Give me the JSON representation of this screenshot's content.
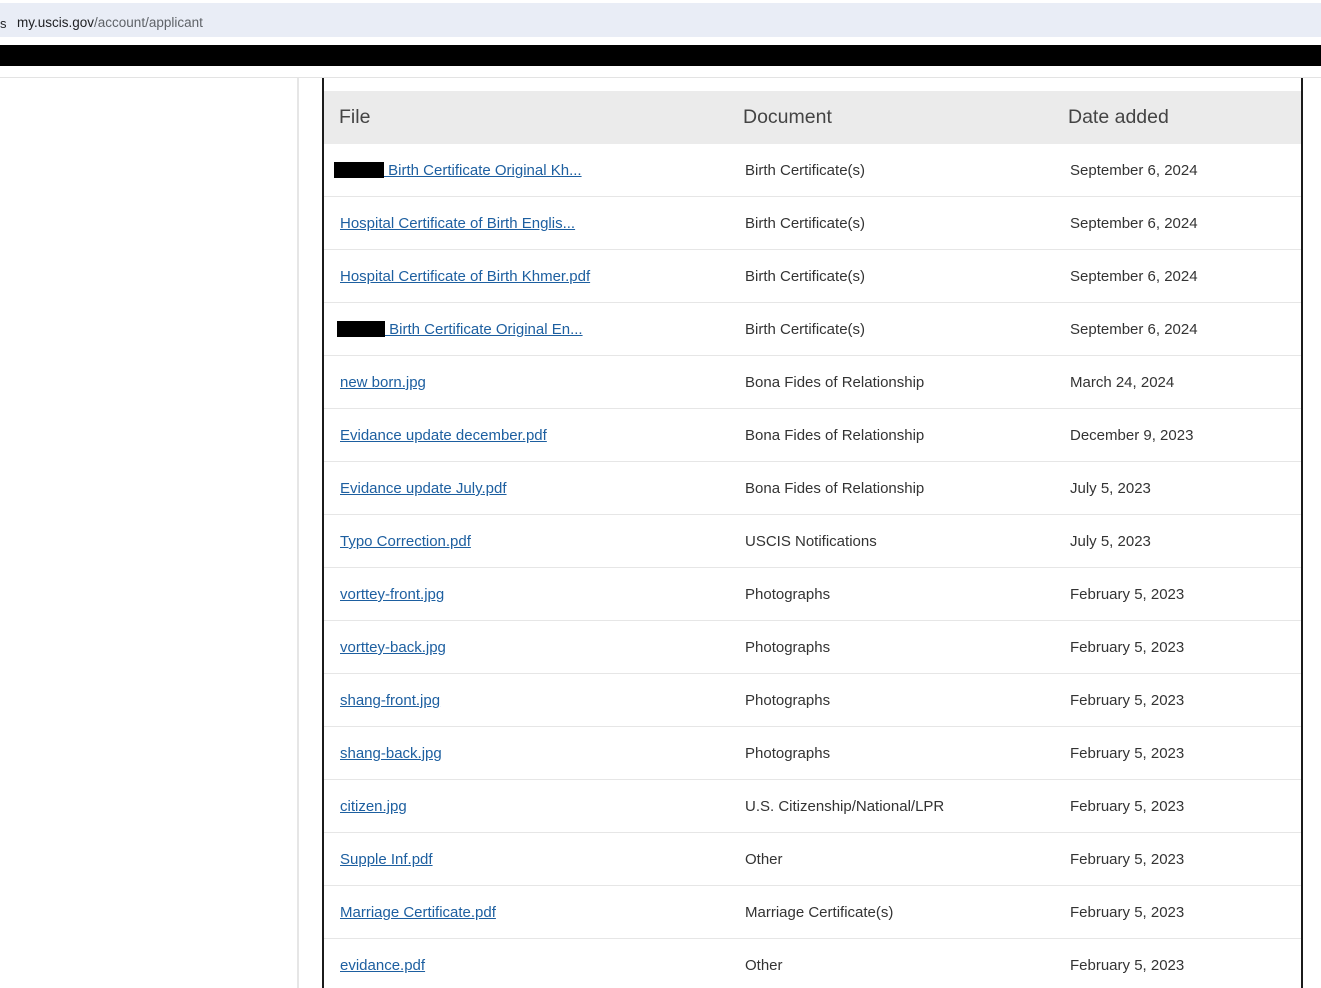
{
  "browser": {
    "url_host": "my.uscis.gov",
    "url_path": "/account/applicant",
    "edge_glyph": "s"
  },
  "table": {
    "headers": {
      "file": "File",
      "document": "Document",
      "date": "Date added"
    },
    "rows": [
      {
        "file": " Birth Certificate Original Kh...",
        "redacted": true,
        "document": "Birth Certificate(s)",
        "date": "September 6, 2024"
      },
      {
        "file": "Hospital Certificate of Birth Englis...",
        "redacted": false,
        "document": "Birth Certificate(s)",
        "date": "September 6, 2024"
      },
      {
        "file": "Hospital Certificate of Birth Khmer.pdf",
        "redacted": false,
        "document": "Birth Certificate(s)",
        "date": "September 6, 2024"
      },
      {
        "file": " Birth Certificate Original En...",
        "redacted": true,
        "document": "Birth Certificate(s)",
        "date": "September 6, 2024"
      },
      {
        "file": "new born.jpg",
        "redacted": false,
        "document": "Bona Fides of Relationship",
        "date": "March 24, 2024"
      },
      {
        "file": "Evidance update december.pdf",
        "redacted": false,
        "document": "Bona Fides of Relationship",
        "date": "December 9, 2023"
      },
      {
        "file": "Evidance update July.pdf",
        "redacted": false,
        "document": "Bona Fides of Relationship",
        "date": "July 5, 2023"
      },
      {
        "file": "Typo Correction.pdf",
        "redacted": false,
        "document": "USCIS Notifications",
        "date": "July 5, 2023"
      },
      {
        "file": "vorttey-front.jpg",
        "redacted": false,
        "document": "Photographs",
        "date": "February 5, 2023"
      },
      {
        "file": "vorttey-back.jpg",
        "redacted": false,
        "document": "Photographs",
        "date": "February 5, 2023"
      },
      {
        "file": "shang-front.jpg",
        "redacted": false,
        "document": "Photographs",
        "date": "February 5, 2023"
      },
      {
        "file": "shang-back.jpg",
        "redacted": false,
        "document": "Photographs",
        "date": "February 5, 2023"
      },
      {
        "file": "citizen.jpg",
        "redacted": false,
        "document": "U.S. Citizenship/National/LPR",
        "date": "February 5, 2023"
      },
      {
        "file": "Supple Inf.pdf",
        "redacted": false,
        "document": "Other",
        "date": "February 5, 2023"
      },
      {
        "file": "Marriage Certificate.pdf",
        "redacted": false,
        "document": "Marriage Certificate(s)",
        "date": "February 5, 2023"
      },
      {
        "file": "evidance.pdf",
        "redacted": false,
        "document": "Other",
        "date": "February 5, 2023"
      }
    ]
  },
  "colors": {
    "link": "#1d5fa0",
    "header_bg": "#ebebeb",
    "text": "#333333",
    "redaction": "#000000"
  }
}
